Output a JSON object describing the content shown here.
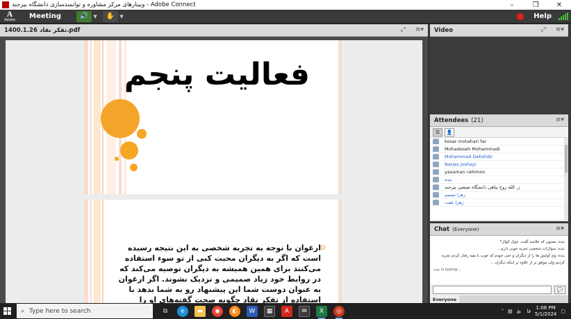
{
  "window": {
    "title": "وبینارهای مرکز مشاوره و توانمندسازی دانشگاه بیرجند - Adobe Connect",
    "controls": [
      "–",
      "❐",
      "✕"
    ]
  },
  "menubar": {
    "logo_letter": "A",
    "logo_sub": "Adobe",
    "meeting_label": "Meeting",
    "help_label": "Help",
    "colors": {
      "speaker_on": "#3f7d2c",
      "record": "#e0201a",
      "signal": "#43c43a"
    }
  },
  "share_pod": {
    "file_name": "1400.1.26 تفکر نقاد.pdf",
    "slide1": {
      "title": "فعالیت پنجم",
      "accent_color": "#f4a428"
    },
    "slide2": {
      "body": "ارغوان با توجه به تجربه شخصی به این نتیجه رسیده است که اگر به دیگران محبت کنی از تو سوء استفاده می‌کنند برای همین همیشه به دیگران توصیه می‌کند که در روابط خود زیاد صمیمی و نزدیک نشوند. اگر ارغوان به عنوان دوست شما این پیشنهاد رو به شما بدهد با استفاده از تفکر نقاد چگونه صحت گفته‌های او را بررسی می‌کنید"
    }
  },
  "video_pod": {
    "title": "Video"
  },
  "attendees_pod": {
    "title": "Attendees",
    "count": "(21)",
    "rows": [
      {
        "name": "kosar motahari far",
        "highlight": false
      },
      {
        "name": "Mohadeseh Mohammadi",
        "highlight": false
      },
      {
        "name": "Mohammad Dehshibi",
        "highlight": true
      },
      {
        "name": "Narjes joshayi",
        "highlight": true
      },
      {
        "name": "yasaman rahimon",
        "highlight": false
      },
      {
        "name": "بنده",
        "highlight": true
      },
      {
        "name": "ز. الله روح پناهی دانشگاه صنعتی بیرجند",
        "highlight": false
      },
      {
        "name": "زهرا تسنیم",
        "highlight": true
      },
      {
        "name": "زهرا عفت",
        "highlight": true
      }
    ]
  },
  "chat_pod": {
    "title": "Chat",
    "scope": "(Everyone)",
    "messages": [
      "بنده: ممنون که خلاصه گفت. چوک کوال؟",
      "بنده: سوال‌ات شخصی تجربه خوبی دارم...",
      "بنده: وی آوایش ها را از دیگران و حتی خودم که خوب با بقیه رفتار کردم تجربه کردیم ولی موفق تر از علاوه بر اینکه دیگران ..."
    ],
    "typing": "بنده is typing...",
    "tab_everyone": "Everyone"
  },
  "taskbar": {
    "search_placeholder": "Type here to search",
    "time": "1:08 PM",
    "date": "5/1/2024",
    "lang": "فا"
  }
}
